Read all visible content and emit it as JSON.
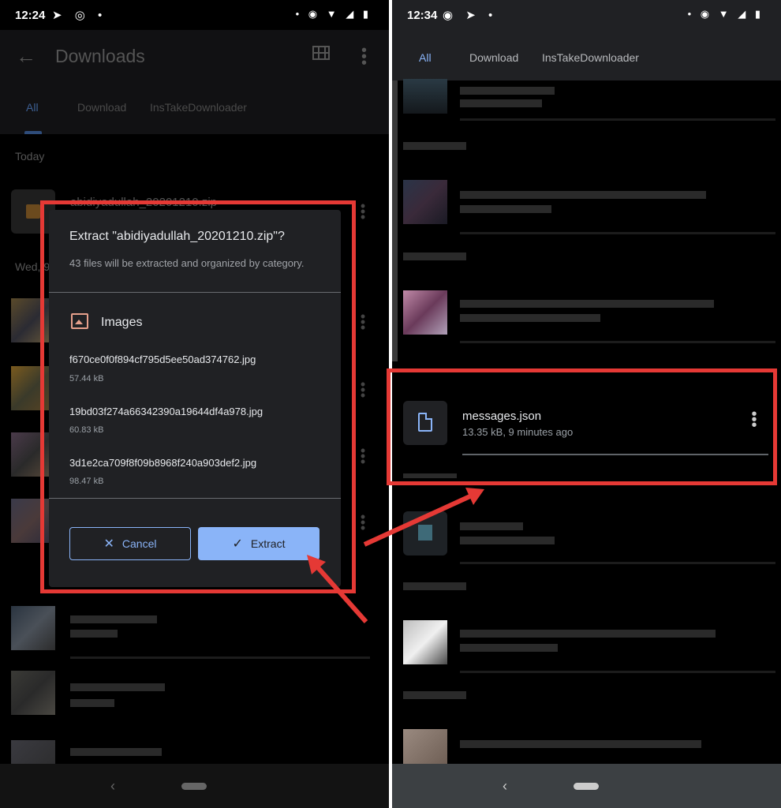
{
  "left": {
    "status": {
      "time": "12:24",
      "left_icons": "➤ ◎ •",
      "right_icons": "• ◉ ▼ ◢ ▮"
    },
    "app_title": "Downloads",
    "tabs": [
      "All",
      "Download",
      "InsTakeDownloader"
    ],
    "section_today": "Today",
    "section_wed": "Wed, 9",
    "zip_name": "abidiyadullah_20201210.zip",
    "dialog": {
      "title": "Extract \"abidiyadullah_20201210.zip\"?",
      "subtitle": "43 files will be extracted and organized by category.",
      "category": "Images",
      "files": [
        {
          "name": "f670ce0f0f894cf795d5ee50ad374762.jpg",
          "size": "57.44 kB"
        },
        {
          "name": "19bd03f274a66342390a19644df4a978.jpg",
          "size": "60.83 kB"
        },
        {
          "name": "3d1e2ca709f8f09b8968f240a903def2.jpg",
          "size": "98.47 kB"
        }
      ],
      "cancel_label": "Cancel",
      "extract_label": "Extract"
    }
  },
  "right": {
    "status": {
      "time": "12:34",
      "left_icons": "◉ ➤ •",
      "right_icons": "• ◉ ▼ ◢ ▮"
    },
    "tabs": [
      "All",
      "Download",
      "InsTakeDownloader"
    ],
    "file": {
      "name": "messages.json",
      "meta": "13.35 kB, 9 minutes ago"
    }
  },
  "annotation_color": "#e53935",
  "accent_color": "#8ab4f8"
}
